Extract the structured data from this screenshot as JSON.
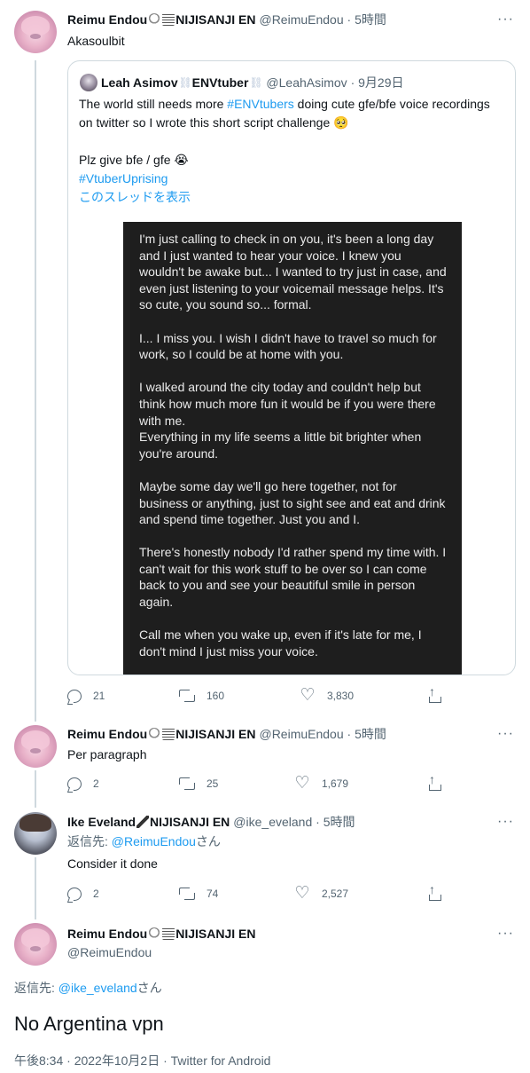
{
  "tweets": [
    {
      "name": "Reimu Endou",
      "badge": "NIJISANJI EN",
      "handle": "@ReimuEndou",
      "time": "5時間",
      "text": "Akasoulbit",
      "quote": {
        "name": "Leah Asimov",
        "badge": "ENVtuber",
        "handle": "@LeahAsimov",
        "date": "9月29日",
        "line1_prefix": "The world still needs more ",
        "line1_tag": "#ENVtubers",
        "line1_suffix": " doing cute gfe/bfe voice recordings on twitter so I wrote this short script challenge 🥺",
        "line2": "Plz give bfe / gfe 😭",
        "hashtag": "#VtuberUprising",
        "show_thread": "このスレッドを表示",
        "image_paragraphs": [
          "I'm just calling to check in on you, it's been a long day and I just wanted to hear your voice. I knew you wouldn't be awake but... I wanted to try just in case, and even just listening to your voicemail message helps. It's so cute, you sound so... formal.",
          "I... I miss you. I wish I didn't have to travel so much for work, so I could be at home with you.",
          "I walked around the city today and couldn't help but think how much more fun it would be if you were there with me.",
          "Everything in my life seems a little bit brighter when you're around.",
          "Maybe some day we'll go here together, not for business or anything, just to sight see and eat and drink and spend time together. Just you and I.",
          "There's honestly nobody I'd rather spend my time with. I can't wait for this work stuff to be over so I can come back to you and see your beautiful smile in person again.",
          "Call me when you wake up, even if it's late for me, I don't mind I just miss your voice."
        ]
      },
      "replies": "21",
      "retweets": "160",
      "likes": "3,830"
    },
    {
      "name": "Reimu Endou",
      "badge": "NIJISANJI EN",
      "handle": "@ReimuEndou",
      "time": "5時間",
      "text": "Per paragraph",
      "replies": "2",
      "retweets": "25",
      "likes": "1,679"
    },
    {
      "name": "Ike Eveland",
      "badge": "NIJISANJI EN",
      "handle": "@ike_eveland",
      "time": "5時間",
      "reply_to_prefix": "返信先: ",
      "reply_to_handle": "@ReimuEndou",
      "reply_to_suffix": "さん",
      "text": "Consider it done",
      "replies": "2",
      "retweets": "74",
      "likes": "2,527"
    }
  ],
  "focused": {
    "name": "Reimu Endou",
    "badge": "NIJISANJI EN",
    "handle": "@ReimuEndou",
    "reply_to_prefix": "返信先: ",
    "reply_to_handle": "@ike_eveland",
    "reply_to_suffix": "さん",
    "text": "No Argentina vpn",
    "meta": "午後8:34 · 2022年10月2日 · Twitter for Android"
  },
  "more_icon": "···",
  "separator": " · ",
  "colors": {
    "link": "#1d9bf0",
    "secondary": "#536471",
    "border": "#cfd9de"
  }
}
